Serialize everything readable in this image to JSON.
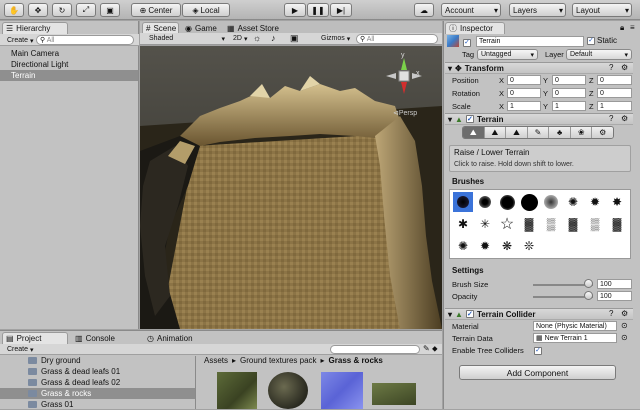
{
  "toolbar": {
    "center_label": "Center",
    "local_label": "Local",
    "account_label": "Account",
    "layers_label": "Layers",
    "layout_label": "Layout"
  },
  "hierarchy": {
    "tab": "Hierarchy",
    "create": "Create",
    "search_placeholder": "All",
    "items": [
      "Main Camera",
      "Directional Light",
      "Terrain"
    ]
  },
  "scene": {
    "tabs": [
      "Scene",
      "Game",
      "Asset Store"
    ],
    "shading": "Shaded",
    "mode_2d": "2D",
    "gizmos": "Gizmos",
    "search_placeholder": "All",
    "persp": "Persp",
    "axis_y": "y",
    "axis_x": "x"
  },
  "project": {
    "tabs": [
      "Project",
      "Console",
      "Animation"
    ],
    "create": "Create",
    "folders": [
      "Dry ground",
      "Grass & dead leafs 01",
      "Grass & dead leafs 02",
      "Grass & rocks",
      "Grass 01"
    ],
    "selected_folder": "Grass & rocks",
    "breadcrumb": [
      "Assets",
      "Ground textures pack",
      "Grass & rocks"
    ]
  },
  "inspector": {
    "tab": "Inspector",
    "object_name": "Terrain",
    "static_label": "Static",
    "tag_label": "Tag",
    "tag_value": "Untagged",
    "layer_label": "Layer",
    "layer_value": "Default",
    "transform": {
      "title": "Transform",
      "rows": [
        {
          "label": "Position",
          "x": "0",
          "y": "0",
          "z": "0"
        },
        {
          "label": "Rotation",
          "x": "0",
          "y": "0",
          "z": "0"
        },
        {
          "label": "Scale",
          "x": "1",
          "y": "1",
          "z": "1"
        }
      ]
    },
    "terrain": {
      "title": "Terrain",
      "tool_title": "Raise / Lower Terrain",
      "tool_help": "Click to raise. Hold down shift to lower.",
      "brushes_label": "Brushes",
      "settings_label": "Settings",
      "brush_size_label": "Brush Size",
      "brush_size_value": "100",
      "brush_size_level": 1.0,
      "opacity_label": "Opacity",
      "opacity_value": "100",
      "opacity_level": 1.0
    },
    "collider": {
      "title": "Terrain Collider",
      "material_label": "Material",
      "material_value": "None (Physic Material)",
      "data_label": "Terrain Data",
      "data_value": "New Terrain 1",
      "trees_label": "Enable Tree Colliders"
    },
    "add_component": "Add Component"
  }
}
